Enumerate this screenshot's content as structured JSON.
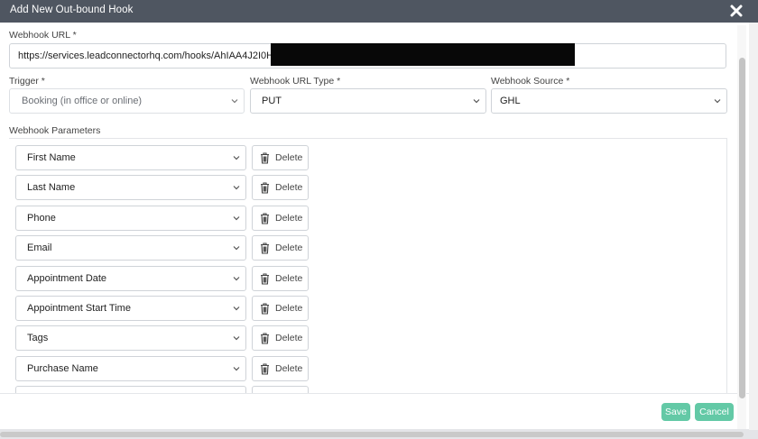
{
  "modal": {
    "title": "Add New Out-bound Hook"
  },
  "webhook_url": {
    "label": "Webhook URL *",
    "value": "https://services.leadconnectorhq.com/hooks/AhIAA4J2I0Ht"
  },
  "trigger": {
    "label": "Trigger *",
    "selected": "Booking (in office or online)"
  },
  "url_type": {
    "label": "Webhook URL Type *",
    "selected": "PUT"
  },
  "source": {
    "label": "Webhook Source *",
    "selected": "GHL"
  },
  "params": {
    "label": "Webhook Parameters",
    "delete_label": "Delete",
    "rows": [
      "First Name",
      "Last Name",
      "Phone",
      "Email",
      "Appointment Date",
      "Appointment Start Time",
      "Tags",
      "Purchase Name",
      ""
    ]
  },
  "footer": {
    "save_label": "Save",
    "cancel_label": "Cancel"
  },
  "colors": {
    "titlebar": "#4f5661",
    "accent_green": "#63c9a6"
  }
}
